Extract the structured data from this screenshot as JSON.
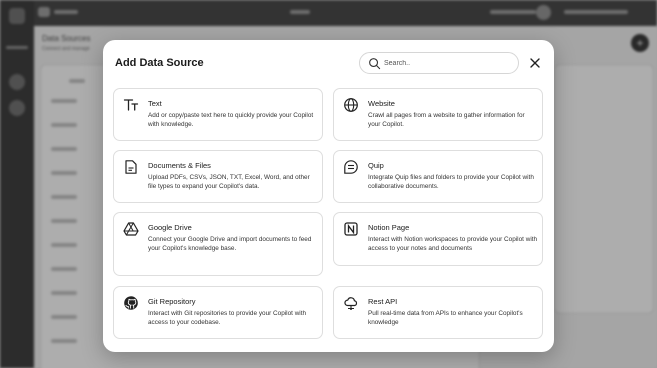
{
  "modal": {
    "title": "Add Data Source",
    "search_placeholder": "Search..",
    "close_icon": "close-icon"
  },
  "sources": [
    {
      "icon": "text-icon",
      "title": "Text",
      "desc": "Add or copy/paste text here to quickly provide your Copilot with knowledge."
    },
    {
      "icon": "globe-icon",
      "title": "Website",
      "desc": "Crawl all pages from a website to gather information for your Copilot."
    },
    {
      "icon": "document-icon",
      "title": "Documents & Files",
      "desc": "Upload PDFs, CSVs, JSON, TXT, Excel, Word, and other file types to expand your Copilot's data."
    },
    {
      "icon": "quip-icon",
      "title": "Quip",
      "desc": "Integrate Quip files and folders to provide your Copilot with collaborative documents."
    },
    {
      "icon": "google-drive-icon",
      "title": "Google Drive",
      "desc": "Connect your Google Drive and import documents to feed your Copilot's knowledge base."
    },
    {
      "icon": "notion-icon",
      "title": "Notion Page",
      "desc": "Interact with Notion workspaces to provide your Copilot with access to your notes and documents"
    },
    {
      "icon": "github-icon",
      "title": "Git Repository",
      "desc": "Interact with Git repositories to provide your Copilot with access to your codebase."
    },
    {
      "icon": "api-cloud-icon",
      "title": "Rest API",
      "desc": "Pull real-time data from APIs to enhance your Copilot's knowledge"
    }
  ],
  "background": {
    "page_title": "Data Sources",
    "page_subtitle": "Connect and manage",
    "column_header": "Name",
    "plus_label": "+"
  }
}
